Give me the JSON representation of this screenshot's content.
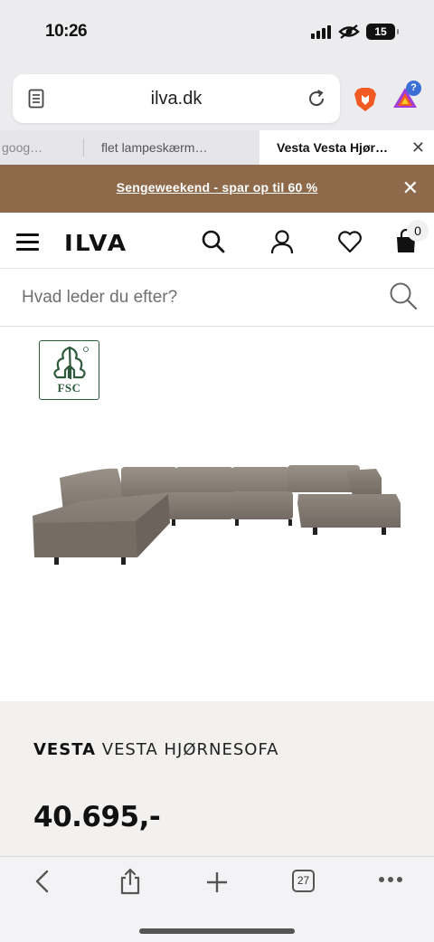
{
  "status": {
    "time": "10:26",
    "battery": "15"
  },
  "browser": {
    "url": "ilva.dk",
    "tabs": [
      {
        "label": "goog…"
      },
      {
        "label": "flet lampeskærm…"
      },
      {
        "label": "Vesta Vesta Hjør…"
      }
    ],
    "tab_count": "27",
    "rewards_badge": "?"
  },
  "promo": {
    "text": "Sengeweekend - spar op til 60 %",
    "close": "✕"
  },
  "header": {
    "logo": "ILVA",
    "bag_count": "0"
  },
  "search": {
    "placeholder": "Hvad leder du efter?"
  },
  "badge": {
    "label": "FSC"
  },
  "product": {
    "brand": "VESTA",
    "model": "VESTA HJØRNESOFA",
    "price": "40.695,-"
  },
  "colors": {
    "promo_bg": "#8e6a4a",
    "info_bg": "#f2f1ef",
    "sofa": "#8b8379",
    "fsc_green": "#2d5a3b"
  }
}
